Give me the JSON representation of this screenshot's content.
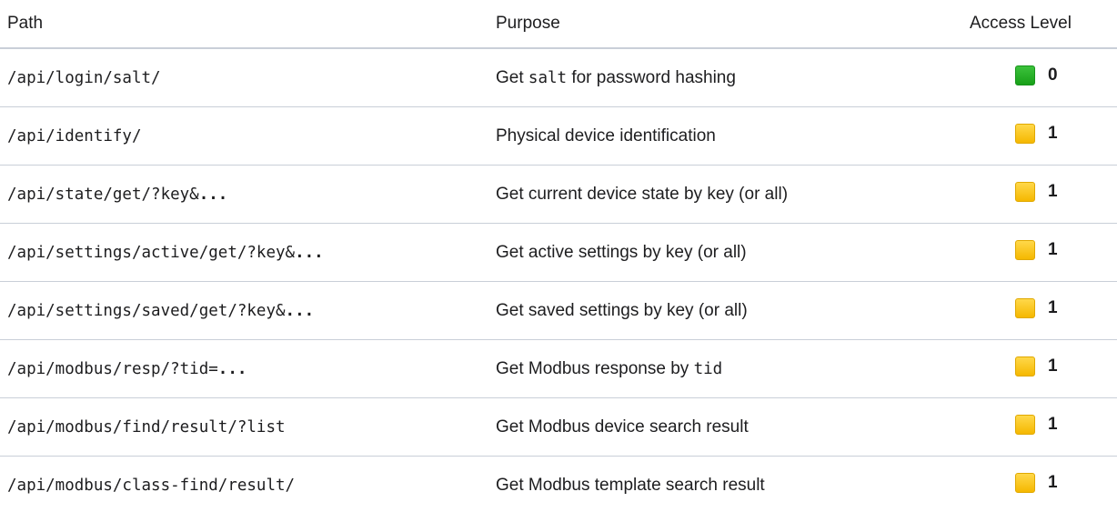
{
  "headers": {
    "path": "Path",
    "purpose": "Purpose",
    "access": "Access Level"
  },
  "colors": {
    "level_0": "#22aa22",
    "level_1": "#f7c200",
    "divider": "#c9cfd8"
  },
  "rows": [
    {
      "path_base": "/api/login/salt/",
      "path_suffix": "",
      "purpose_pre": "Get ",
      "purpose_code": "salt",
      "purpose_post": " for password hashing",
      "level_icon": "green-square-icon",
      "level": "0"
    },
    {
      "path_base": "/api/identify/",
      "path_suffix": "",
      "purpose_pre": "Physical device identification",
      "purpose_code": "",
      "purpose_post": "",
      "level_icon": "yellow-square-icon",
      "level": "1"
    },
    {
      "path_base": "/api/state/get/?key&",
      "path_suffix": "...",
      "purpose_pre": "Get current device state by key (or all)",
      "purpose_code": "",
      "purpose_post": "",
      "level_icon": "yellow-square-icon",
      "level": "1"
    },
    {
      "path_base": "/api/settings/active/get/?key&",
      "path_suffix": "...",
      "purpose_pre": "Get active settings by key (or all)",
      "purpose_code": "",
      "purpose_post": "",
      "level_icon": "yellow-square-icon",
      "level": "1"
    },
    {
      "path_base": "/api/settings/saved/get/?key&",
      "path_suffix": "...",
      "purpose_pre": "Get saved settings by key (or all)",
      "purpose_code": "",
      "purpose_post": "",
      "level_icon": "yellow-square-icon",
      "level": "1"
    },
    {
      "path_base": "/api/modbus/resp/?tid=",
      "path_suffix": "...",
      "purpose_pre": "Get Modbus response by ",
      "purpose_code": "tid",
      "purpose_post": "",
      "level_icon": "yellow-square-icon",
      "level": "1"
    },
    {
      "path_base": "/api/modbus/find/result/?list",
      "path_suffix": "",
      "purpose_pre": "Get Modbus device search result",
      "purpose_code": "",
      "purpose_post": "",
      "level_icon": "yellow-square-icon",
      "level": "1"
    },
    {
      "path_base": "/api/modbus/class-find/result/",
      "path_suffix": "",
      "purpose_pre": "Get Modbus template search result",
      "purpose_code": "",
      "purpose_post": "",
      "level_icon": "yellow-square-icon",
      "level": "1"
    }
  ]
}
